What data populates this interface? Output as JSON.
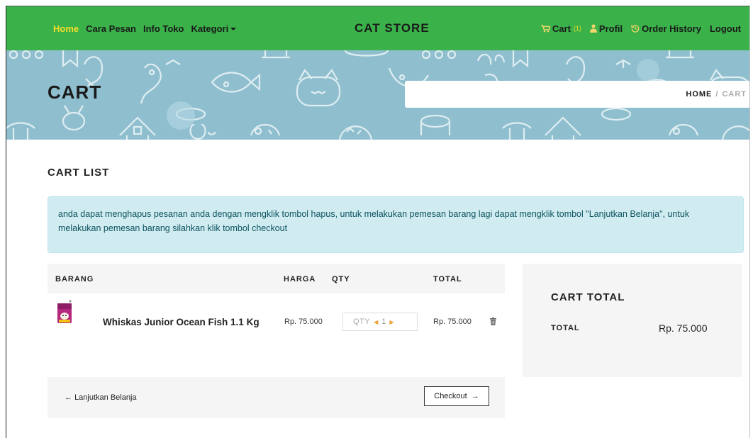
{
  "nav": {
    "left_items": [
      {
        "label": "Home",
        "active": true
      },
      {
        "label": "Cara Pesan",
        "active": false
      },
      {
        "label": "Info Toko",
        "active": false
      },
      {
        "label": "Kategori",
        "active": false,
        "dropdown": true
      }
    ],
    "brand": "CAT STORE",
    "right_items": {
      "cart_label": "Cart",
      "cart_count": "(1)",
      "profil_label": "Profil",
      "history_label": "Order History",
      "logout_label": "Logout"
    },
    "icons": {
      "cart": "cart-icon",
      "profil": "user-icon",
      "history": "history-icon"
    },
    "colors": {
      "background": "#3ab149",
      "active": "#f7dd2c"
    }
  },
  "banner": {
    "title": "CART",
    "breadcrumb": {
      "home": "HOME",
      "separator": "/",
      "current": "CART"
    },
    "background_color": "#8fbfcf"
  },
  "section": {
    "title": "CART LIST"
  },
  "alert": {
    "text": "anda dapat menghapus pesanan anda dengan mengklik tombol hapus, untuk melakukan pemesan barang lagi dapat mengklik tombol \"Lanjutkan Belanja\", untuk melakukan pemesan barang silahkan klik tombol checkout"
  },
  "table": {
    "headers": {
      "item": "BARANG",
      "price": "HARGA",
      "qty": "QTY",
      "total": "TOTAL"
    },
    "rows": [
      {
        "name": "Whiskas Junior Ocean Fish 1.1 Kg",
        "price": "Rp. 75.000",
        "qty_label": "QTY",
        "qty": "1",
        "total": "Rp. 75.000",
        "delete_icon": "trash-icon"
      }
    ]
  },
  "actions": {
    "continue_label": "Lanjutkan Belanja",
    "checkout_label": "Checkout"
  },
  "cart_total": {
    "title": "CART TOTAL",
    "label": "TOTAL",
    "value": "Rp. 75.000"
  }
}
